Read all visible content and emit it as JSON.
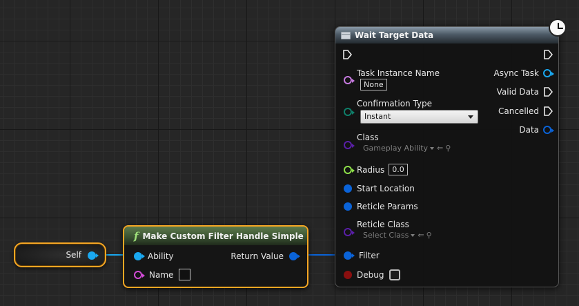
{
  "self_node": {
    "label": "Self",
    "pin_color": "#1aa8f0"
  },
  "function_node": {
    "title": "Make Custom Filter Handle Simple",
    "icon": "function-f-icon",
    "inputs": [
      {
        "label": "Ability",
        "pin": "object",
        "color": "#1aa8f0"
      },
      {
        "label": "Name",
        "pin": "name",
        "color": "#d14bd6"
      }
    ],
    "outputs": [
      {
        "label": "Return Value",
        "pin": "struct",
        "color": "#0a63d8"
      }
    ]
  },
  "wait_node": {
    "title": "Wait Target Data",
    "icon": "task-node-icon",
    "latent_icon": "clock-icon",
    "inputs": {
      "task_instance_name": {
        "label": "Task Instance Name",
        "value": "None",
        "color": "#c77be0"
      },
      "confirmation_type": {
        "label": "Confirmation Type",
        "value": "Instant",
        "color": "#0f7f6a"
      },
      "class": {
        "label": "Class",
        "value": "Gameplay Ability",
        "color": "#5a1fa8"
      },
      "radius": {
        "label": "Radius",
        "value": "0.0",
        "color": "#8fe04a"
      },
      "start_location": {
        "label": "Start Location",
        "color": "#0a63d8"
      },
      "reticle_params": {
        "label": "Reticle Params",
        "color": "#0a63d8"
      },
      "reticle_class": {
        "label": "Reticle Class",
        "value": "Select Class",
        "color": "#5a1fa8"
      },
      "filter": {
        "label": "Filter",
        "color": "#0a63d8"
      },
      "debug": {
        "label": "Debug",
        "color": "#8a0f0f"
      }
    },
    "outputs": {
      "async_task": {
        "label": "Async Task",
        "color": "#1aa8f0"
      },
      "valid_data": {
        "label": "Valid Data"
      },
      "cancelled": {
        "label": "Cancelled"
      },
      "data": {
        "label": "Data",
        "color": "#0a63d8"
      }
    }
  },
  "colors": {
    "selection": "#f5a623",
    "wire_object": "#1aa8f0",
    "wire_struct": "#0a63d8"
  }
}
